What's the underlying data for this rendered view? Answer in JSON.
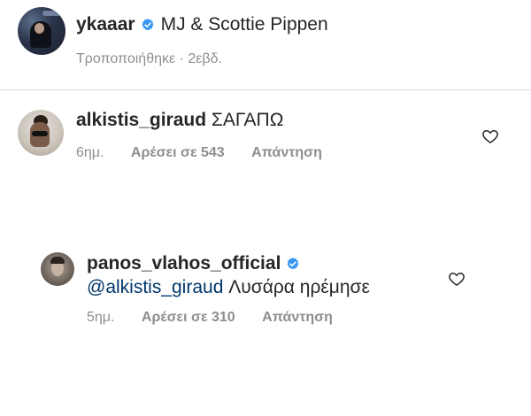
{
  "caption": {
    "username": "ykaaar",
    "text": "MJ & Scottie Pippen",
    "edited_label": "Τροποποιήθηκε",
    "separator": " · ",
    "time": "2εβδ."
  },
  "comments": [
    {
      "username": "alkistis_giraud",
      "text": "ΣΑΓΑΠΩ",
      "time": "6ημ.",
      "likes": "Αρέσει σε 543",
      "reply_label": "Απάντηση",
      "verified": false
    },
    {
      "username": "panos_vlahos_official",
      "mention": "@alkistis_giraud",
      "text": "Λυσάρα ηρέμησε",
      "time": "5ημ.",
      "likes": "Αρέσει σε 310",
      "reply_label": "Απάντηση",
      "verified": true
    }
  ],
  "colors": {
    "text": "#262626",
    "secondary": "#8e8e8e",
    "verified": "#3897f0",
    "mention": "#00376b",
    "divider": "#dbdbdb"
  },
  "icons": {
    "verified": "verified-badge-icon",
    "like": "heart-outline-icon"
  }
}
